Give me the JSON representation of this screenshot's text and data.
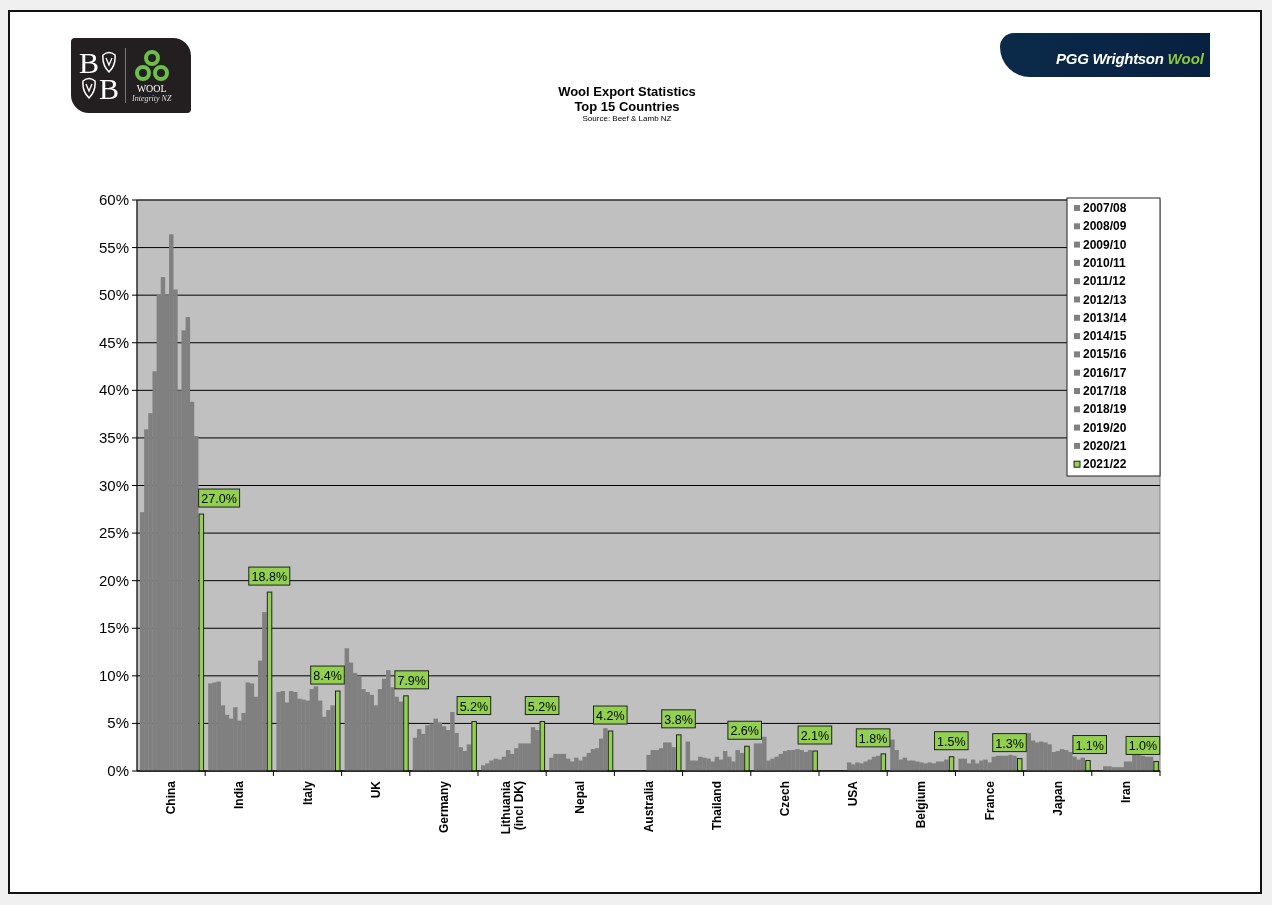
{
  "header": {
    "left_logo": {
      "letters": [
        "B",
        "B"
      ],
      "word": "WOOL",
      "tagline": "Integrity NZ"
    },
    "title": "Wool Export Statistics",
    "subtitle": "Top 15 Countries",
    "source": "Source: Beef & Lamb NZ",
    "right_logo": {
      "name": "PGG Wrightson",
      "accent": "Wool"
    }
  },
  "chart_data": {
    "type": "bar",
    "orientation": "vertical",
    "ylim": [
      0,
      60
    ],
    "grid": true,
    "legend": true,
    "yticks": [
      {
        "value": 0,
        "label": "0%"
      },
      {
        "value": 5,
        "label": "5%"
      },
      {
        "value": 10,
        "label": "10%"
      },
      {
        "value": 15,
        "label": "15%"
      },
      {
        "value": 20,
        "label": "20%"
      },
      {
        "value": 25,
        "label": "25%"
      },
      {
        "value": 30,
        "label": "30%"
      },
      {
        "value": 35,
        "label": "35%"
      },
      {
        "value": 40,
        "label": "40%"
      },
      {
        "value": 45,
        "label": "45%"
      },
      {
        "value": 50,
        "label": "50%"
      },
      {
        "value": 55,
        "label": "55%"
      },
      {
        "value": 60,
        "label": "60%"
      }
    ],
    "categories": [
      "China",
      "India",
      "Italy",
      "UK",
      "Germany",
      "Lithuania\n(incl DK)",
      "Nepal",
      "Australia",
      "Thailand",
      "Czech",
      "USA",
      "Belgium",
      "France",
      "Japan",
      "Iran"
    ],
    "series": [
      {
        "name": "2007/08",
        "color": "#808080",
        "values": [
          27.2,
          9.2,
          8.3,
          12.9,
          3.5,
          0.6,
          1.4,
          null,
          3.1,
          2.9,
          null,
          3.3,
          1.3,
          4.0,
          null
        ]
      },
      {
        "name": "2008/09",
        "color": "#808080",
        "values": [
          35.9,
          9.3,
          8.4,
          11.4,
          4.4,
          0.8,
          1.8,
          null,
          1.1,
          2.9,
          null,
          2.2,
          1.3,
          3.2,
          null
        ]
      },
      {
        "name": "2009/10",
        "color": "#808080",
        "values": [
          37.6,
          9.4,
          7.2,
          10.3,
          3.9,
          1.1,
          1.8,
          null,
          1.1,
          3.6,
          null,
          1.2,
          0.8,
          3.0,
          0.5
        ]
      },
      {
        "name": "2010/11",
        "color": "#808080",
        "values": [
          42.0,
          6.9,
          8.4,
          10.0,
          4.8,
          1.3,
          1.8,
          null,
          1.5,
          1.1,
          null,
          1.4,
          1.2,
          3.1,
          0.5
        ]
      },
      {
        "name": "2011/12",
        "color": "#808080",
        "values": [
          50.1,
          5.9,
          8.3,
          8.6,
          5.0,
          1.2,
          1.3,
          null,
          1.4,
          1.3,
          null,
          1.1,
          0.8,
          3.0,
          0.4
        ]
      },
      {
        "name": "2012/13",
        "color": "#808080",
        "values": [
          51.9,
          5.5,
          7.6,
          8.3,
          5.5,
          1.5,
          1.0,
          null,
          1.3,
          1.5,
          null,
          1.1,
          1.1,
          2.8,
          0.4
        ]
      },
      {
        "name": "2013/14",
        "color": "#808080",
        "values": [
          50.0,
          6.7,
          7.5,
          8.0,
          5.1,
          2.2,
          1.4,
          null,
          1.0,
          1.8,
          0.9,
          1.0,
          1.2,
          2.0,
          0.4
        ]
      },
      {
        "name": "2014/15",
        "color": "#808080",
        "values": [
          56.4,
          5.3,
          7.4,
          6.9,
          4.7,
          1.8,
          1.1,
          1.7,
          1.5,
          2.1,
          0.7,
          0.9,
          0.9,
          2.1,
          1.0
        ]
      },
      {
        "name": "2015/16",
        "color": "#808080",
        "values": [
          50.6,
          6.1,
          8.6,
          8.6,
          4.3,
          2.4,
          1.5,
          2.2,
          1.2,
          2.2,
          0.9,
          0.8,
          1.5,
          2.3,
          1.0
        ]
      },
      {
        "name": "2016/17",
        "color": "#808080",
        "values": [
          40.0,
          9.3,
          8.9,
          9.7,
          6.2,
          2.9,
          1.9,
          2.2,
          2.1,
          2.2,
          0.8,
          0.9,
          1.6,
          2.2,
          1.8
        ]
      },
      {
        "name": "2017/18",
        "color": "#808080",
        "values": [
          46.3,
          9.2,
          7.4,
          10.6,
          4.0,
          2.9,
          2.3,
          2.4,
          1.5,
          2.3,
          1.0,
          0.8,
          1.6,
          2.0,
          1.8
        ]
      },
      {
        "name": "2018/19",
        "color": "#808080",
        "values": [
          47.7,
          7.8,
          5.7,
          8.8,
          2.5,
          2.9,
          2.4,
          3.0,
          1.0,
          2.2,
          1.2,
          1.0,
          1.6,
          1.5,
          1.6
        ]
      },
      {
        "name": "2019/20",
        "color": "#808080",
        "values": [
          38.8,
          11.6,
          6.4,
          7.8,
          2.1,
          4.6,
          3.4,
          3.0,
          2.2,
          2.0,
          1.5,
          1.0,
          1.7,
          1.2,
          1.5
        ]
      },
      {
        "name": "2020/21",
        "color": "#808080",
        "values": [
          35.2,
          16.7,
          6.9,
          7.3,
          2.8,
          4.3,
          4.5,
          2.5,
          1.9,
          2.2,
          1.6,
          1.2,
          1.6,
          1.4,
          1.5
        ]
      },
      {
        "name": "2021/22",
        "color": "#92d050",
        "values": [
          27.0,
          18.8,
          8.4,
          7.9,
          5.2,
          5.2,
          4.2,
          3.8,
          2.6,
          2.1,
          1.8,
          1.5,
          1.3,
          1.1,
          1.0
        ]
      }
    ],
    "value_labels": [
      null,
      null,
      null,
      null,
      null,
      null,
      null,
      null,
      null,
      null,
      null,
      null,
      null,
      null,
      [
        "27.0%",
        "18.8%",
        "8.4%",
        "7.9%",
        "5.2%",
        "5.2%",
        "4.2%",
        "3.8%",
        "2.6%",
        "2.1%",
        "1.8%",
        "1.5%",
        "1.3%",
        "1.1%",
        "1.0%"
      ]
    ]
  }
}
